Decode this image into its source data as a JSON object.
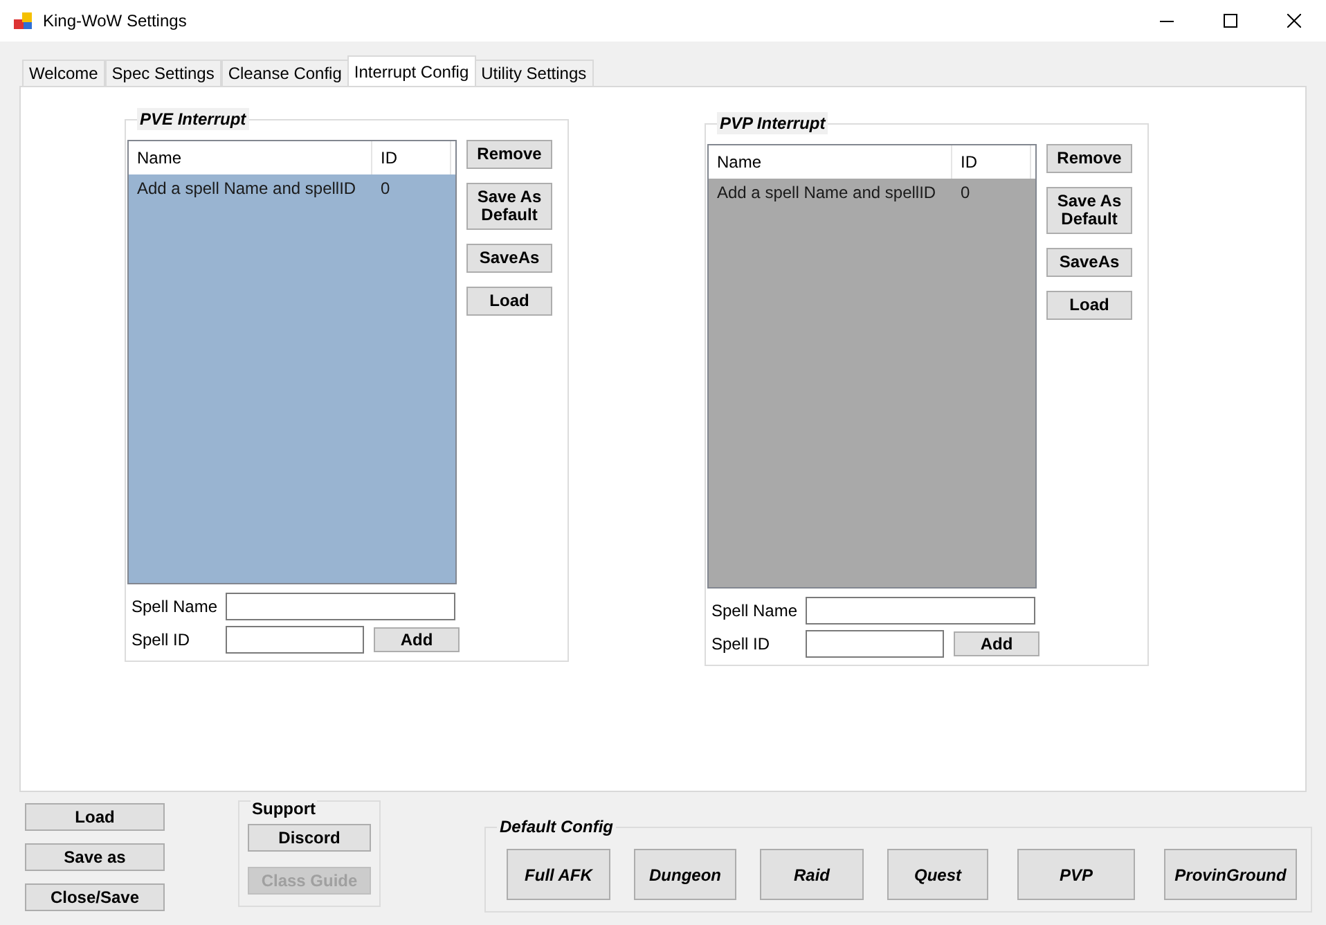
{
  "window": {
    "title": "King-WoW Settings"
  },
  "tabs": [
    {
      "label": "Welcome",
      "selected": false
    },
    {
      "label": "Spec Settings",
      "selected": false
    },
    {
      "label": "Cleanse Config",
      "selected": false
    },
    {
      "label": "Interrupt Config",
      "selected": true
    },
    {
      "label": "Utility Settings",
      "selected": false
    }
  ],
  "groups": [
    {
      "title": "PVE Interrupt",
      "disabled": false,
      "columns": [
        "Name",
        "ID"
      ],
      "rows": [
        [
          "Add a spell Name and spellID",
          "0"
        ]
      ],
      "buttons": [
        "Remove",
        "Save As Default",
        "SaveAs",
        "Load"
      ],
      "spell_name_label": "Spell Name",
      "spell_id_label": "Spell ID",
      "add_button": "Add"
    },
    {
      "title": "PVP Interrupt",
      "disabled": true,
      "columns": [
        "Name",
        "ID"
      ],
      "rows": [
        [
          "Add a spell Name and spellID",
          "0"
        ]
      ],
      "buttons": [
        "Remove",
        "Save As Default",
        "SaveAs",
        "Load"
      ],
      "spell_name_label": "Spell Name",
      "spell_id_label": "Spell ID",
      "add_button": "Add"
    }
  ],
  "file_buttons": [
    "Load",
    "Save as",
    "Close/Save"
  ],
  "support": {
    "title": "Support",
    "buttons": [
      {
        "label": "Discord",
        "disabled": false
      },
      {
        "label": "Class Guide",
        "disabled": true
      }
    ]
  },
  "default_config": {
    "title": "Default Config",
    "buttons": [
      "Full AFK",
      "Dungeon",
      "Raid",
      "Quest",
      "PVP",
      "ProvinGround"
    ]
  }
}
